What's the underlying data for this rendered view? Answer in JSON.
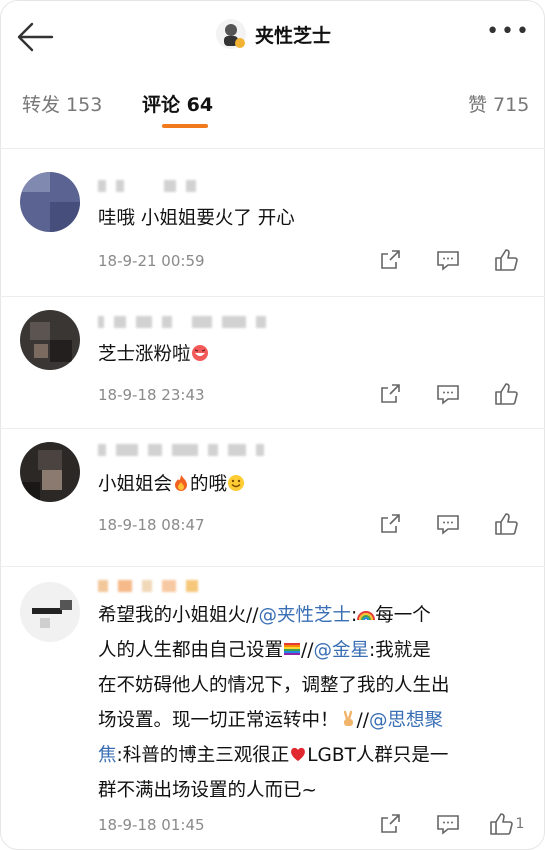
{
  "header": {
    "title": "夹性芝士"
  },
  "tabs": [
    {
      "label": "转发 153"
    },
    {
      "label": "评论 64"
    },
    {
      "label": "赞 715"
    }
  ],
  "comments": [
    {
      "text_parts": [
        "哇哦 小姐姐要火了 开心"
      ],
      "time": "18-9-21 00:59"
    },
    {
      "text_parts": [
        "芝士涨粉啦"
      ],
      "time": "18-9-18 23:43"
    },
    {
      "text_parts": [
        "小姐姐会",
        "的哦"
      ],
      "time": "18-9-18 08:47"
    },
    {
      "line1a": "希望我的小姐姐火//",
      "mention1": "@夹性芝士",
      "line1b": ":",
      "line1c": "每一个",
      "line2a": "人的人生都由自己设置",
      "line2b": "//",
      "mention2": "@金星",
      "line2c": ":我就是",
      "line3": "在不妨碍他人的情况下，调整了我的人生出",
      "line4a": "场设置。现一切正常运转中！",
      "line4b": "//",
      "mention3": "@思想聚",
      "mention3b": "焦",
      "line5a": ":科普的博主三观很正",
      "line5b": "LGBT人群只是一",
      "line6": "群不满出场设置的人而已~",
      "time": "18-9-18 01:45",
      "likes": "1"
    }
  ],
  "colors": {
    "accent": "#f07a1c",
    "mention": "#3a6fb5"
  }
}
